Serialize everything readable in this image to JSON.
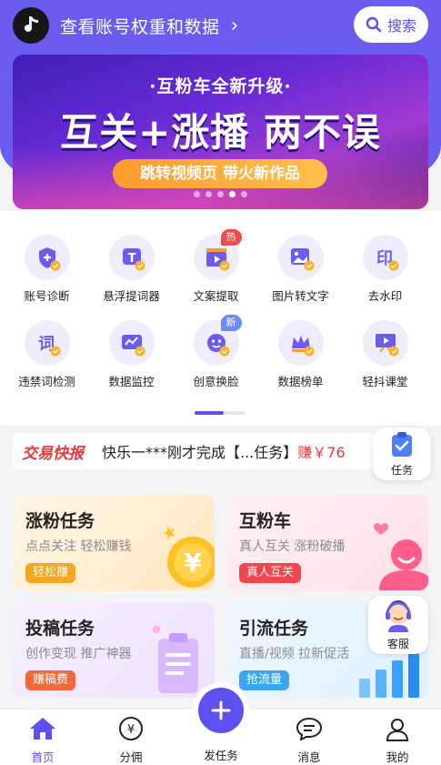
{
  "header": {
    "title": "查看账号权重和数据",
    "search_label": "搜索"
  },
  "banner": {
    "subtitle": "·互粉车全新升级·",
    "headline": "互关+涨播 两不误",
    "pill": "跳转视频页 带火新作品",
    "slides": 5,
    "active_slide": 4
  },
  "tools": [
    {
      "label": "账号诊断",
      "icon": "shield-check-icon"
    },
    {
      "label": "悬浮提词器",
      "icon": "teleprompter-icon"
    },
    {
      "label": "文案提取",
      "icon": "clapperboard-icon",
      "badge": "热",
      "badge_color": "#f04a4a"
    },
    {
      "label": "图片转文字",
      "icon": "image-text-icon"
    },
    {
      "label": "去水印",
      "icon": "stamp-icon"
    },
    {
      "label": "违禁词检测",
      "icon": "word-check-icon"
    },
    {
      "label": "数据监控",
      "icon": "monitor-chart-icon"
    },
    {
      "label": "创意换脸",
      "icon": "face-swap-icon",
      "badge": "新",
      "badge_color": "#6b8cf5"
    },
    {
      "label": "数据榜单",
      "icon": "crown-icon"
    },
    {
      "label": "轻抖课堂",
      "icon": "easel-icon"
    }
  ],
  "news": {
    "logo": "交易快报",
    "text": "快乐一***刚才完成【...任务】",
    "amount": "赚￥76"
  },
  "task_float": {
    "label": "任务"
  },
  "cards": [
    {
      "title": "涨粉任务",
      "subtitle": "点点关注 轻松赚钱",
      "tag": "轻松赚",
      "tag_color": "#f4a623"
    },
    {
      "title": "互粉车",
      "subtitle": "真人互关 涨粉破播",
      "tag": "真人互关",
      "tag_color": "#f0464e"
    },
    {
      "title": "投稿任务",
      "subtitle": "创作变现 推广神器",
      "tag": "赚稿费",
      "tag_color": "#f26a3a"
    },
    {
      "title": "引流任务",
      "subtitle": "直播/视频 拉新促活",
      "tag": "抢流量",
      "tag_color": "#3aa8f0"
    }
  ],
  "kefu_float": {
    "label": "客服"
  },
  "nav": {
    "home": "首页",
    "commission": "分佣",
    "publish": "发任务",
    "messages": "消息",
    "mine": "我的"
  },
  "colors": {
    "accent": "#5d4ff0",
    "header_bg": "#6b5cf0"
  }
}
